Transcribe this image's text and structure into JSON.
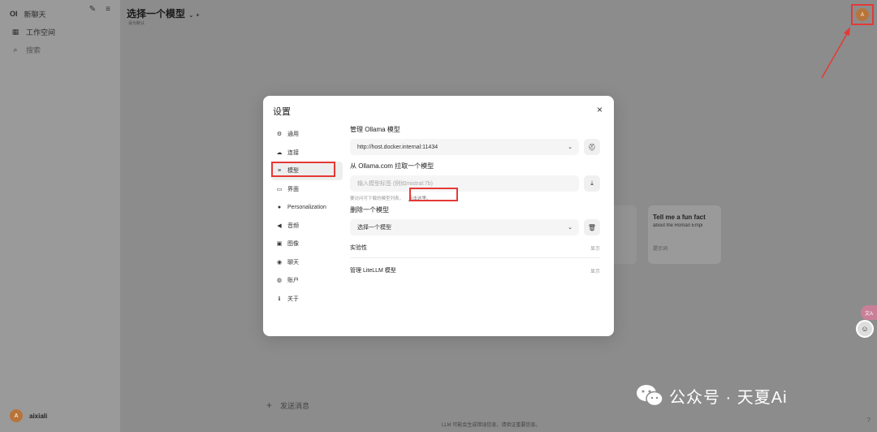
{
  "sidebar": {
    "logo": "OI",
    "new_chat": "新聊天",
    "workspace": "工作空间",
    "search": "搜索",
    "user_initial": "A",
    "user_name": "aixiali"
  },
  "header": {
    "model_select": "选择一个模型",
    "model_sub": "设为默认",
    "avatar_initial": "A"
  },
  "suggestion": {
    "title": "Tell me a fun fact",
    "subtitle": "about the Roman Empi",
    "tag": "提示词"
  },
  "chat": {
    "placeholder": "发送消息",
    "disclaimer": "LLM 可能会生成错误信息，请验证重要信息。",
    "help": "?"
  },
  "floater": {
    "pill": "文A"
  },
  "watermark": {
    "text": "公众号 · 天夏Ai"
  },
  "modal": {
    "title": "设置",
    "close": "×",
    "nav": [
      {
        "icon": "⚙",
        "label": "通用"
      },
      {
        "icon": "☁",
        "label": "连接"
      },
      {
        "icon": "≡",
        "label": "模型"
      },
      {
        "icon": "▭",
        "label": "界面"
      },
      {
        "icon": "●",
        "label": "Personalization"
      },
      {
        "icon": "◀",
        "label": "音频"
      },
      {
        "icon": "▣",
        "label": "图像"
      },
      {
        "icon": "◉",
        "label": "聊天"
      },
      {
        "icon": "◍",
        "label": "账户"
      },
      {
        "icon": "ℹ",
        "label": "关于"
      }
    ],
    "manage_ollama": "管理 Ollama 模型",
    "ollama_url": "http://host.docker.internal:11434",
    "pull_title": "从 Ollama.com 拉取一个模型",
    "pull_placeholder": "输入模型标签 (例如mistral:7b)",
    "hint_text": "要访问可下载的模型列表，",
    "hint_link": "点击这里。",
    "delete_title": "删除一个模型",
    "delete_select": "选择一个模型",
    "experimental": "实验性",
    "show1": "显示",
    "manage_litellm": "管理 LiteLLM 模型",
    "show2": "显示"
  }
}
